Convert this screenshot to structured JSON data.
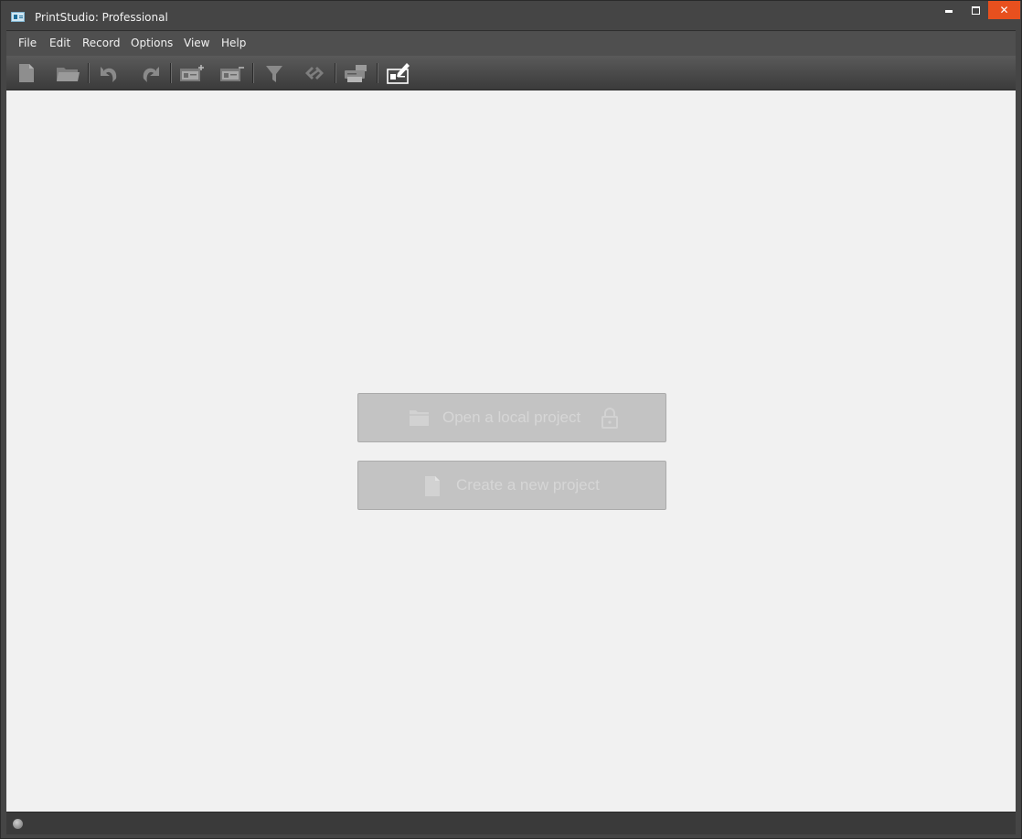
{
  "window": {
    "title": "PrintStudio: Professional",
    "controls": {
      "minimize": "",
      "maximize": "",
      "close": "✕"
    },
    "accent_close": "#e8501e"
  },
  "menubar": {
    "items": [
      {
        "label": "File"
      },
      {
        "label": "Edit"
      },
      {
        "label": "Record"
      },
      {
        "label": "Options"
      },
      {
        "label": "View"
      },
      {
        "label": "Help"
      }
    ]
  },
  "toolbar": {
    "buttons": [
      {
        "icon": "new-document-icon"
      },
      {
        "icon": "open-folder-icon"
      },
      {
        "icon": "undo-icon"
      },
      {
        "icon": "redo-icon"
      },
      {
        "icon": "add-card-icon"
      },
      {
        "icon": "remove-card-icon"
      },
      {
        "icon": "filter-icon"
      },
      {
        "icon": "link-icon"
      },
      {
        "icon": "printer-icon"
      },
      {
        "icon": "card-editor-icon"
      }
    ]
  },
  "main": {
    "open_local_project": {
      "label": "Open a local project",
      "icon": "folder-icon",
      "trailing_icon": "lock-icon"
    },
    "create_new_project": {
      "label": "Create a new project",
      "icon": "document-icon"
    }
  },
  "statusbar": {
    "indicator": "status-indicator-icon"
  }
}
